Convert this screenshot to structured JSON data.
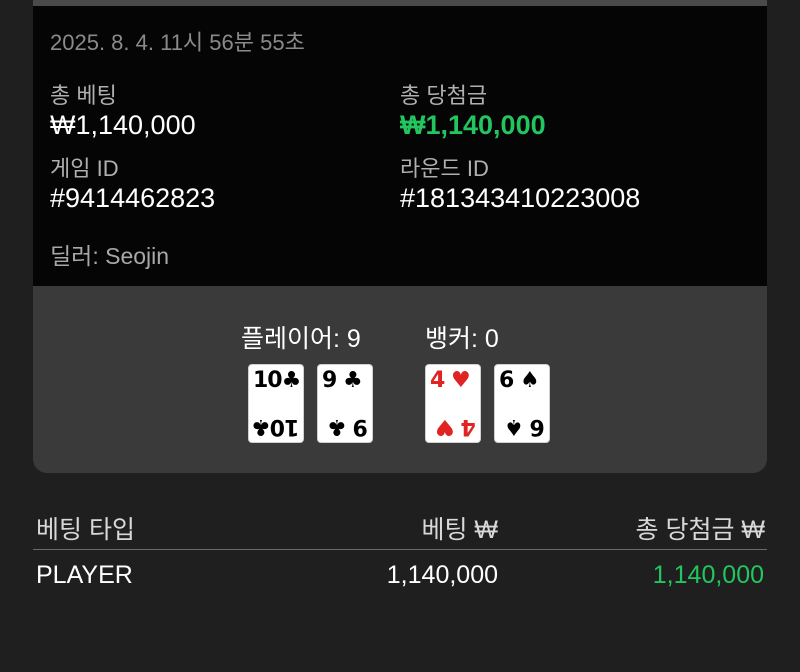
{
  "round": {
    "timestamp": "2025. 8. 4. 11시 56분 55초",
    "total_bet_label": "총 베팅",
    "total_bet_value": "₩1,140,000",
    "total_win_label": "총 당첨금",
    "total_win_value": "₩1,140,000",
    "game_id_label": "게임 ID",
    "game_id_value": "#9414462823",
    "round_id_label": "라운드 ID",
    "round_id_value": "#181343410223008",
    "dealer": "딜러: Seojin"
  },
  "hands": {
    "player_label": "플레이어: 9",
    "banker_label": "뱅커: 0",
    "player_cards": [
      {
        "rank": "10",
        "suit": "♣",
        "color": "#000000"
      },
      {
        "rank": "9",
        "suit": "♣",
        "color": "#000000"
      }
    ],
    "banker_cards": [
      {
        "rank": "4",
        "suit": "♥",
        "color": "#e02424"
      },
      {
        "rank": "6",
        "suit": "♠",
        "color": "#000000"
      }
    ]
  },
  "table": {
    "headers": [
      "베팅 타입",
      "베팅 ₩",
      "총 당첨금 ₩"
    ],
    "rows": [
      {
        "type": "PLAYER",
        "bet": "1,140,000",
        "win": "1,140,000"
      }
    ]
  },
  "colors": {
    "win_green": "#22c55e",
    "panel_bg": "#3a3a3a",
    "info_bg": "#050505",
    "page_bg": "#1f1f1f"
  }
}
